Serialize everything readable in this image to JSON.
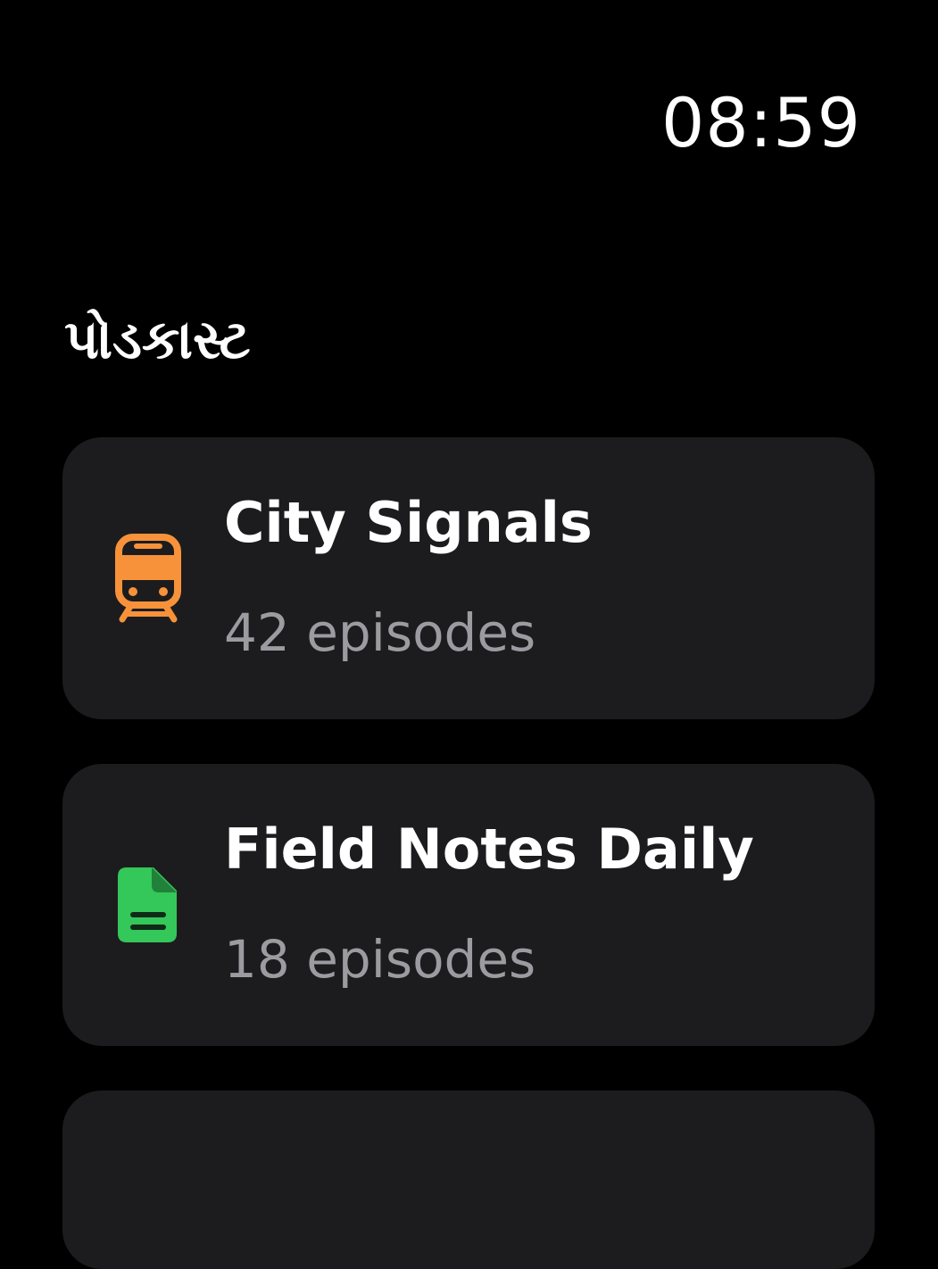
{
  "status": {
    "time": "08:59"
  },
  "header": {
    "title": "પોડકાસ્ટ"
  },
  "podcasts": [
    {
      "title": "City Signals",
      "episodes": "42 episodes",
      "icon": "train-icon",
      "color": "#f7923a"
    },
    {
      "title": "Field Notes Daily",
      "episodes": "18 episodes",
      "icon": "document-icon",
      "color": "#34c759"
    }
  ]
}
